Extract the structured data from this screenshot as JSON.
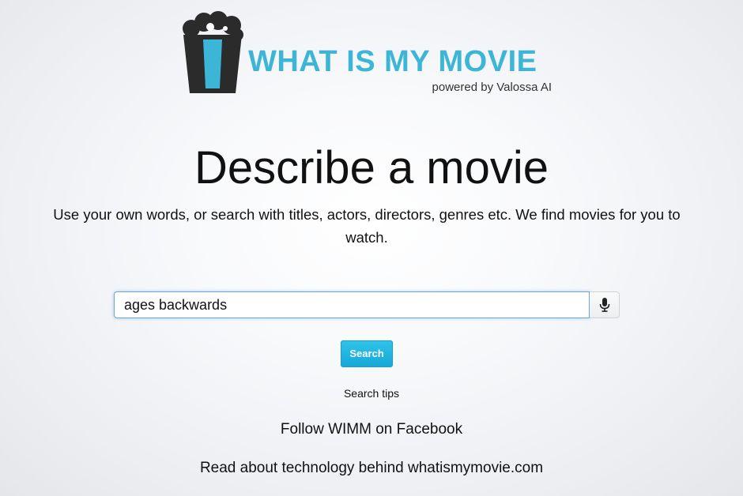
{
  "logo": {
    "title": "WHAT IS MY MOVIE",
    "subtitle": "powered by Valossa AI",
    "icon": "popcorn-box-icon",
    "accent_color": "#3cb5d6",
    "dark_color": "#2b2b2b"
  },
  "main": {
    "headline": "Describe a movie",
    "description": "Use your own words, or search with titles, actors, directors, genres etc. We find movies for you to watch."
  },
  "search": {
    "value": "ages backwards",
    "placeholder": "",
    "mic_icon": "microphone-icon",
    "button_label": "Search",
    "button_color": "#1fb3e0"
  },
  "links": {
    "search_tips": "Search tips",
    "facebook": "Follow WIMM on Facebook",
    "technology": "Read about technology behind whatismymovie.com"
  }
}
